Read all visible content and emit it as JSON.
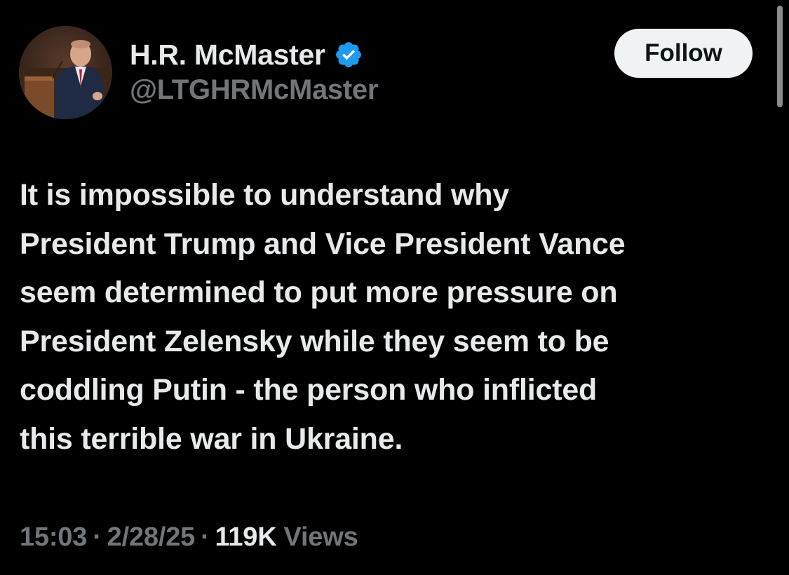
{
  "author": {
    "display_name": "H.R. McMaster",
    "handle": "@LTGHRMcMaster",
    "verified": true,
    "avatar_icon": "profile-photo"
  },
  "actions": {
    "follow_label": "Follow"
  },
  "tweet": {
    "lines": [
      "It is impossible to understand why",
      "President Trump and Vice President Vance",
      "seem determined to put more pressure on",
      "President Zelensky while they seem to be",
      "coddling Putin - the person who inflicted",
      "this terrible war in Ukraine."
    ]
  },
  "meta": {
    "time": "15:03",
    "separator": "·",
    "date": "2/28/25",
    "views_count": "119K",
    "views_label": "Views"
  },
  "colors": {
    "background": "#000000",
    "primary_text": "#e7e9ea",
    "secondary_text": "#71767b",
    "verified_blue": "#1d9bf0",
    "follow_bg": "#eff3f4",
    "follow_text": "#0f1419"
  }
}
